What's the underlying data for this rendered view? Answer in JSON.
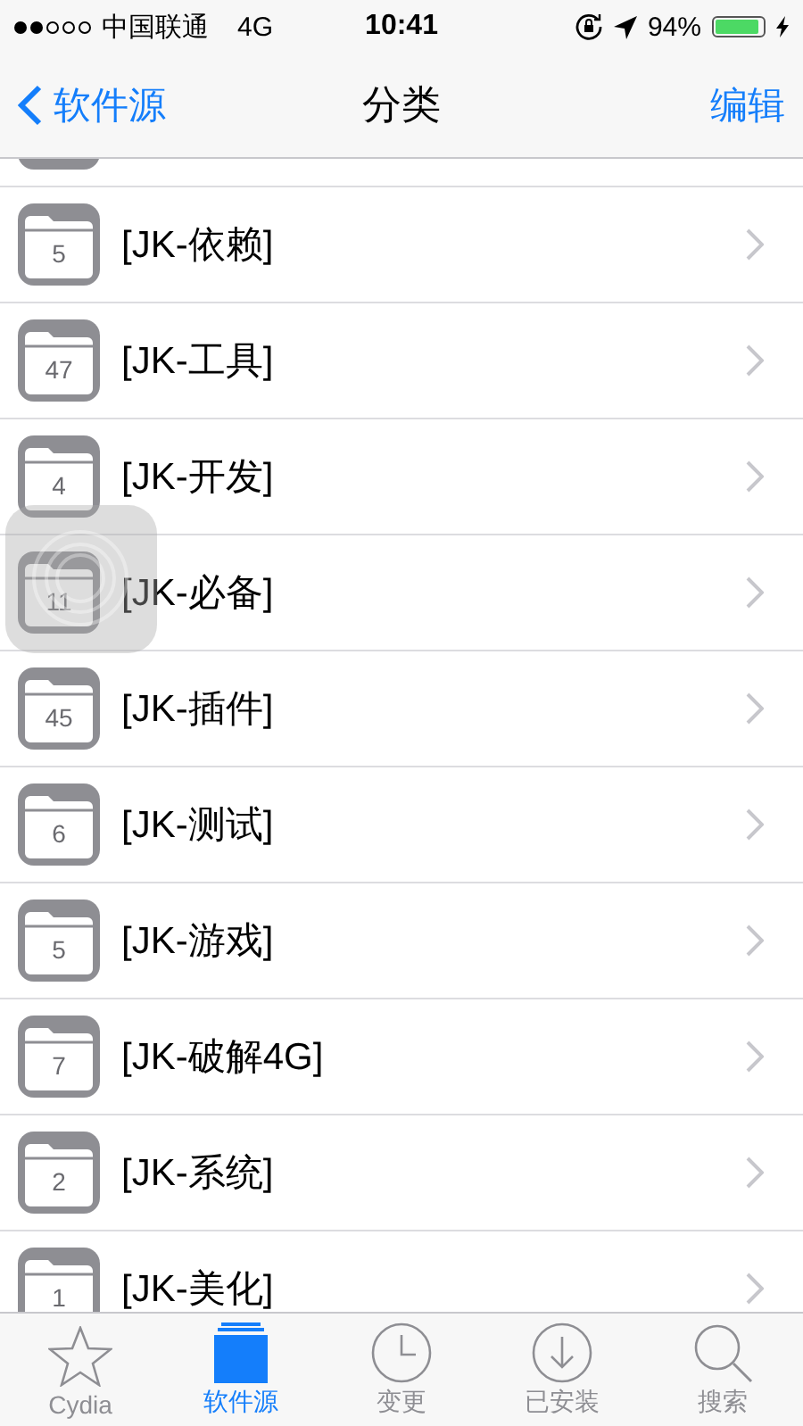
{
  "status_bar": {
    "carrier": "中国联通",
    "network": "4G",
    "time": "10:41",
    "battery_text": "94%",
    "battery": {
      "level": 0.94
    }
  },
  "nav_bar": {
    "back": "软件源",
    "title": "分类",
    "action": "编辑"
  },
  "rows": [
    {
      "count": "5",
      "label": "[JK-依赖]"
    },
    {
      "count": "47",
      "label": "[JK-工具]"
    },
    {
      "count": "4",
      "label": "[JK-开发]"
    },
    {
      "count": "11",
      "label": "[JK-必备]"
    },
    {
      "count": "45",
      "label": "[JK-插件]"
    },
    {
      "count": "6",
      "label": "[JK-测试]"
    },
    {
      "count": "5",
      "label": "[JK-游戏]"
    },
    {
      "count": "7",
      "label": "[JK-破解4G]"
    },
    {
      "count": "2",
      "label": "[JK-系统]"
    },
    {
      "count": "1",
      "label": "[JK-美化]"
    }
  ],
  "tab_bar": [
    {
      "kind": "star",
      "label": "Cydia",
      "selected": false
    },
    {
      "kind": "sources",
      "label": "软件源",
      "selected": true
    },
    {
      "kind": "clock",
      "label": "变更",
      "selected": false
    },
    {
      "kind": "installed",
      "label": "已安装",
      "selected": false
    },
    {
      "kind": "search",
      "label": "搜索",
      "selected": false
    }
  ]
}
